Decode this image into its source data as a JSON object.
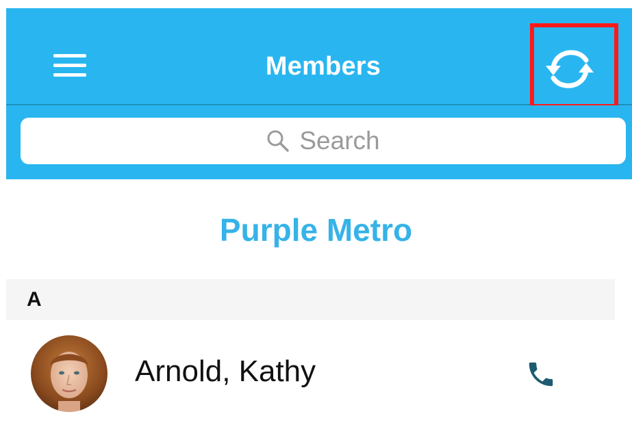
{
  "header": {
    "title": "Members",
    "menu_icon": "hamburger-menu-icon",
    "refresh_icon": "refresh-sync-icon",
    "highlight_color": "#ff1a1a"
  },
  "search": {
    "placeholder": "Search",
    "icon": "search-icon"
  },
  "group": {
    "title": "Purple Metro"
  },
  "sections": [
    {
      "letter": "A",
      "members": [
        {
          "name": "Arnold, Kathy",
          "avatar_icon": "avatar",
          "call_icon": "phone-icon"
        }
      ]
    }
  ],
  "colors": {
    "nav_bg": "#29b6f0",
    "group_title": "#36b3e8",
    "phone_icon": "#1f5b70",
    "section_bg": "#f5f5f5"
  }
}
